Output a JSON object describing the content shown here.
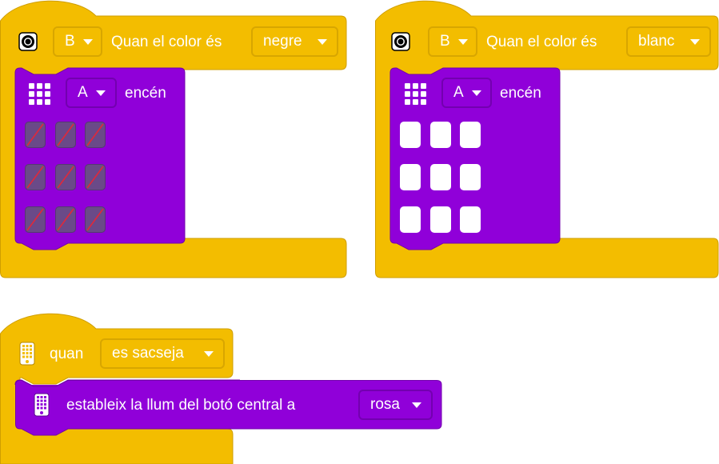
{
  "colors": {
    "event_yellow": "#f3bd00",
    "action_purple": "#9000d9",
    "pixel_off": "#6a4a88",
    "pixel_on": "#ffffff",
    "off_slash": "#e0283a"
  },
  "blocks": [
    {
      "event_icon": "color-sensor-icon",
      "port": "B",
      "text": "Quan el color és",
      "color_value": "negre",
      "action": {
        "icon": "light-matrix-icon",
        "port": "A",
        "text": "encén",
        "pixels": [
          [
            false,
            false,
            false
          ],
          [
            false,
            false,
            false
          ],
          [
            false,
            false,
            false
          ]
        ]
      }
    },
    {
      "event_icon": "color-sensor-icon",
      "port": "B",
      "text": "Quan el color és",
      "color_value": "blanc",
      "action": {
        "icon": "light-matrix-icon",
        "port": "A",
        "text": "encén",
        "pixels": [
          [
            true,
            true,
            true
          ],
          [
            true,
            true,
            true
          ],
          [
            true,
            true,
            true
          ]
        ]
      }
    }
  ],
  "shake_block": {
    "event_icon": "hub-icon",
    "text": "quan",
    "gesture": "es sacseja",
    "action": {
      "icon": "hub-icon",
      "text": "estableix la llum del botó central a",
      "color_value": "rosa"
    }
  }
}
